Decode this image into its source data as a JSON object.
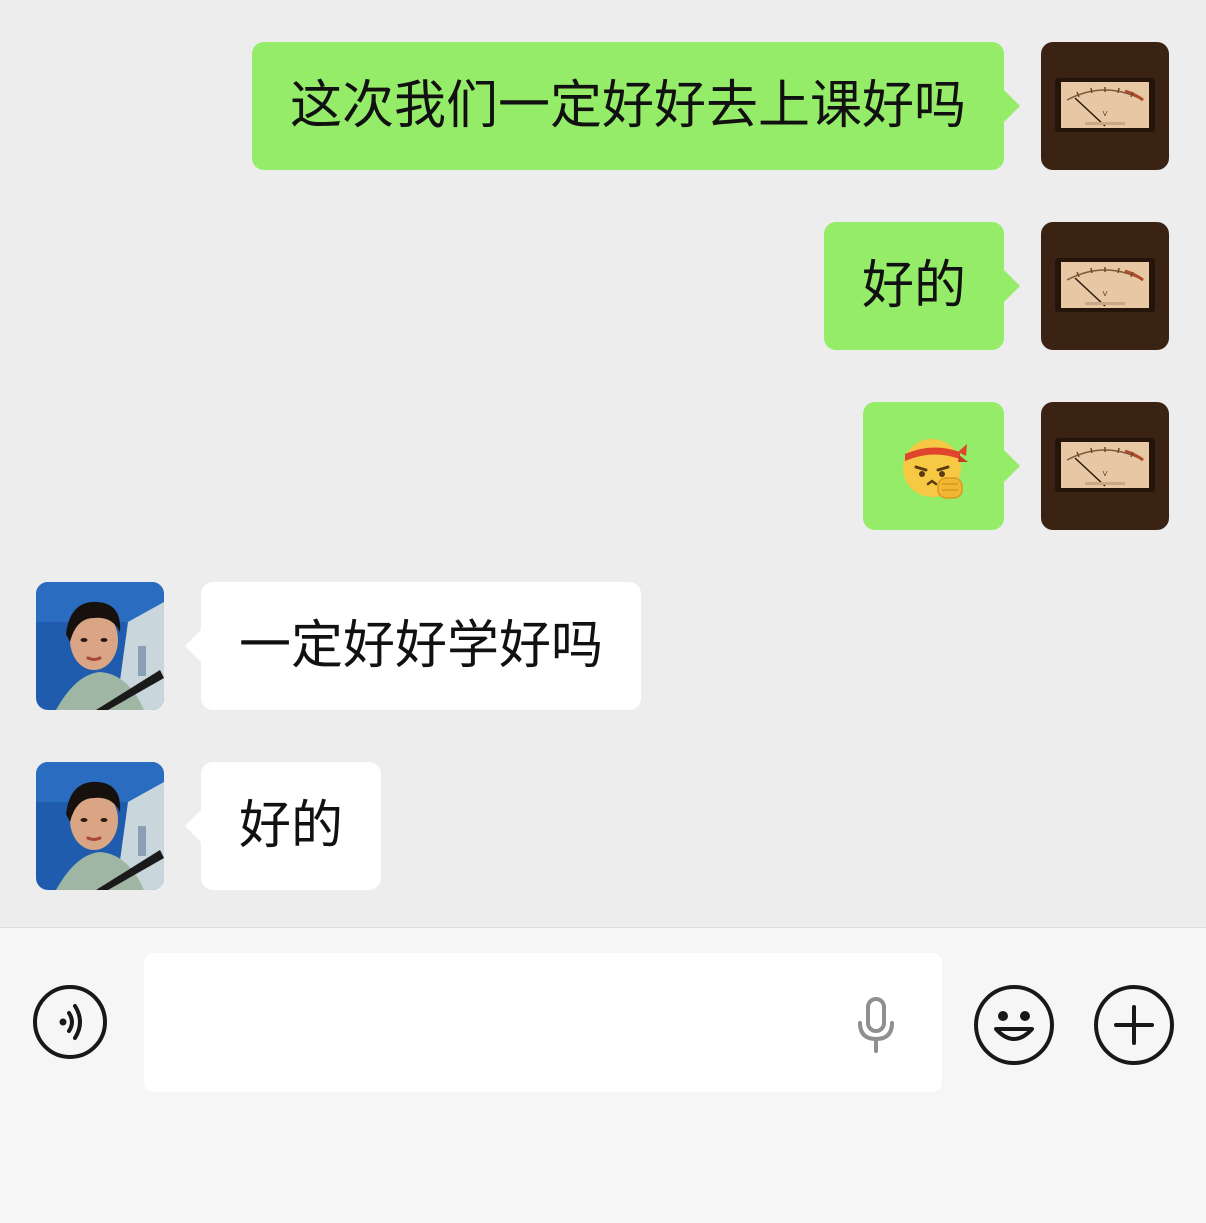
{
  "messages": [
    {
      "direction": "out",
      "type": "text",
      "text": "这次我们一定好好去上课好吗",
      "avatar": "vu-meter-avatar"
    },
    {
      "direction": "out",
      "type": "text",
      "text": "好的",
      "avatar": "vu-meter-avatar"
    },
    {
      "direction": "out",
      "type": "emoji",
      "emoji": "determined-headband-fist-emoji",
      "avatar": "vu-meter-avatar"
    },
    {
      "direction": "in",
      "type": "text",
      "text": "一定好好学好吗",
      "avatar": "portrait-avatar"
    },
    {
      "direction": "in",
      "type": "text",
      "text": "好的",
      "avatar": "portrait-avatar"
    }
  ],
  "input_bar": {
    "voice_button_icon": "voice-wave-icon",
    "text_value": "",
    "placeholder": "",
    "mic_icon": "microphone-icon",
    "emoji_button_icon": "smiley-icon",
    "more_button_icon": "plus-icon"
  },
  "colors": {
    "outgoing_bubble": "#95ec69",
    "incoming_bubble": "#ffffff",
    "chat_background": "#ededed",
    "input_bar_background": "#f6f6f6"
  }
}
